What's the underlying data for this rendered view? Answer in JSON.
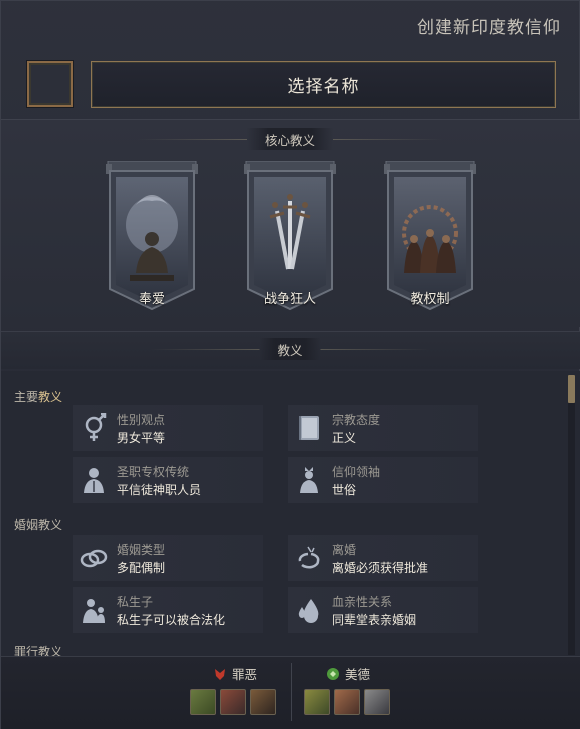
{
  "header": {
    "title": "创建新印度教信仰"
  },
  "name_field": {
    "label": "选择名称"
  },
  "core_tenets": {
    "heading": "核心教义",
    "items": [
      {
        "label": "奉爱",
        "icon": "meditation-icon"
      },
      {
        "label": "战争狂人",
        "icon": "swords-icon"
      },
      {
        "label": "教权制",
        "icon": "clergy-icon"
      }
    ]
  },
  "doctrines": {
    "heading": "教义",
    "groups": [
      {
        "label_plain": "主要",
        "label_accent": "教义",
        "items": [
          {
            "title": "性别观点",
            "value": "男女平等",
            "icon": "gender-icon"
          },
          {
            "title": "宗教态度",
            "value": "正义",
            "icon": "book-icon"
          },
          {
            "title": "圣职专权传统",
            "value": "平信徒神职人员",
            "icon": "priest-icon"
          },
          {
            "title": "信仰领袖",
            "value": "世俗",
            "icon": "leader-icon"
          }
        ]
      },
      {
        "label_plain": "婚姻教义",
        "label_accent": "",
        "items": [
          {
            "title": "婚姻类型",
            "value": "多配偶制",
            "icon": "rings-icon"
          },
          {
            "title": "离婚",
            "value": "离婚必须获得批准",
            "icon": "broken-ring-icon"
          },
          {
            "title": "私生子",
            "value": "私生子可以被合法化",
            "icon": "child-icon"
          },
          {
            "title": "血亲性关系",
            "value": "同辈堂表亲婚姻",
            "icon": "blood-drop-icon"
          }
        ]
      },
      {
        "label_plain": "罪行教义",
        "label_accent": ""
      }
    ]
  },
  "footer": {
    "sins_label": "罪恶",
    "virtues_label": "美德",
    "colors": {
      "sin": "#c0392b",
      "virtue": "#4f9a3c"
    }
  }
}
